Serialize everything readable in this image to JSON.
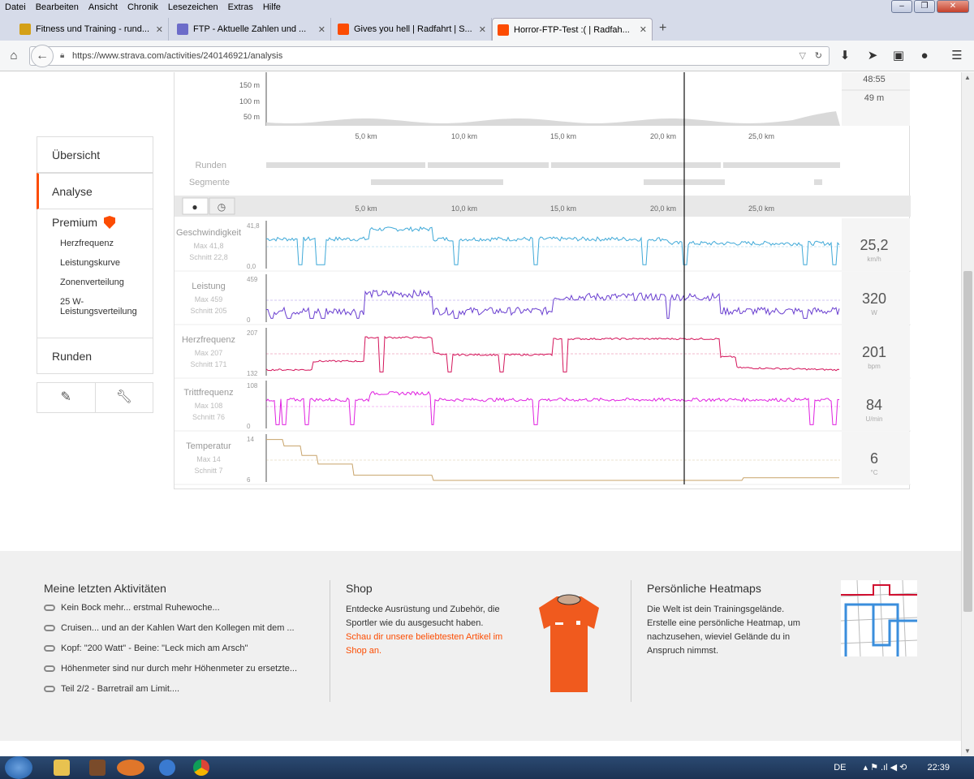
{
  "menu": [
    "Datei",
    "Bearbeiten",
    "Ansicht",
    "Chronik",
    "Lesezeichen",
    "Extras",
    "Hilfe"
  ],
  "tabs": [
    {
      "label": "Fitness und Training - rund...",
      "color": "#d4a017"
    },
    {
      "label": "FTP - Aktuelle Zahlen und ...",
      "color": "#6c6cc9"
    },
    {
      "label": "Gives you hell | Radfahrt | S...",
      "color": "#fc4c02"
    },
    {
      "label": "Horror-FTP-Test :( | Radfah...",
      "color": "#fc4c02"
    }
  ],
  "url": "https://www.strava.com/activities/240146921/analysis",
  "nav": {
    "overview": "Übersicht",
    "analysis": "Analyse",
    "premium": "Premium",
    "premium_items": [
      "Herzfrequenz",
      "Leistungskurve",
      "Zonenverteilung",
      "25 W-Leistungsverteilung"
    ],
    "laps": "Runden"
  },
  "elevation": {
    "ticks": [
      "150 m",
      "100 m",
      "50 m"
    ],
    "side_values": [
      "48:55",
      "49 m"
    ]
  },
  "km_ticks": [
    "5,0 km",
    "10,0 km",
    "15,0 km",
    "20,0 km",
    "25,0 km"
  ],
  "rows": {
    "laps": "Runden",
    "segments": "Segmente"
  },
  "charts": [
    {
      "name": "Geschwindigkeit",
      "max": "Max 41,8",
      "avg": "Schnitt 22,8",
      "top": "41,8",
      "bottom": "0,0",
      "value": "25,2",
      "unit": "km/h",
      "color": "#3fa9d8"
    },
    {
      "name": "Leistung",
      "max": "Max 459",
      "avg": "Schnitt 205",
      "top": "459",
      "bottom": "0",
      "value": "320",
      "unit": "W",
      "color": "#6a3fd0"
    },
    {
      "name": "Herzfrequenz",
      "max": "Max 207",
      "avg": "Schnitt 171",
      "top": "207",
      "bottom": "132",
      "value": "201",
      "unit": "bpm",
      "color": "#d4145a"
    },
    {
      "name": "Trittfrequenz",
      "max": "Max 108",
      "avg": "Schnitt 76",
      "top": "108",
      "bottom": "0",
      "value": "84",
      "unit": "U/min",
      "color": "#e020e0"
    },
    {
      "name": "Temperatur",
      "max": "Max 14",
      "avg": "Schnitt 7",
      "top": "14",
      "bottom": "6",
      "value": "6",
      "unit": "°C",
      "color": "#c8a36a"
    }
  ],
  "footer": {
    "recent_title": "Meine letzten Aktivitäten",
    "recent": [
      "Kein Bock mehr... erstmal Ruhewoche...",
      "Cruisen... und an der Kahlen Wart den Kollegen mit dem ...",
      "Kopf: \"200 Watt\" - Beine: \"Leck mich am Arsch\"",
      "Höhenmeter sind nur durch mehr Höhenmeter zu ersetzte...",
      "Teil 2/2 - Barretrail am Limit...."
    ],
    "shop_title": "Shop",
    "shop_text": "Entdecke Ausrüstung und Zubehör, die Sportler wie du ausgesucht haben.",
    "shop_link": "Schau dir unsere beliebtesten Artikel im Shop an.",
    "heat_title": "Persönliche Heatmaps",
    "heat_text1": "Die Welt ist dein Trainingsgelände.",
    "heat_text2": "Erstelle eine persönliche Heatmap, um nachzusehen, wieviel Gelände du in Anspruch nimmst."
  },
  "taskbar": {
    "lang": "DE",
    "time": "22:39"
  }
}
